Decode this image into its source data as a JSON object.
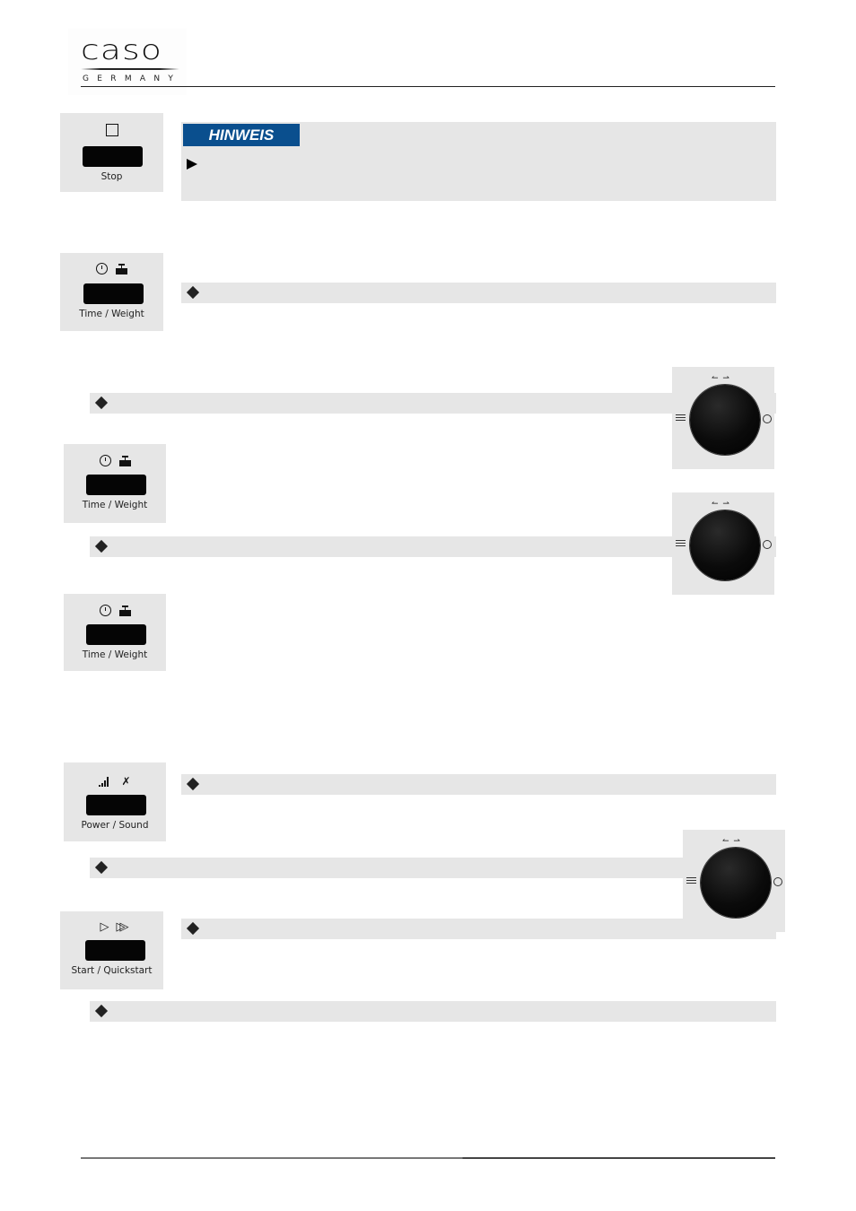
{
  "header": {
    "logo_word": "caso",
    "logo_sub": "GERMANY"
  },
  "hinweis": {
    "badge": "HINWEIS",
    "bullet_icon": "triangle-arrow-icon"
  },
  "buttons": [
    {
      "id": "stop",
      "label": "Stop",
      "icons": [
        "square-icon"
      ]
    },
    {
      "id": "time-weight-1",
      "label": "Time / Weight",
      "icons": [
        "clock-icon",
        "weight-icon"
      ]
    },
    {
      "id": "time-weight-2",
      "label": "Time / Weight",
      "icons": [
        "clock-icon",
        "weight-icon"
      ]
    },
    {
      "id": "time-weight-3",
      "label": "Time / Weight",
      "icons": [
        "clock-icon",
        "weight-icon"
      ]
    },
    {
      "id": "power-sound",
      "label": "Power / Sound",
      "icons": [
        "power-level-icon",
        "mute-icon"
      ]
    },
    {
      "id": "start-quickstart",
      "label": "Start / Quickstart",
      "icons": [
        "play-icon",
        "fast-forward-icon"
      ]
    }
  ],
  "glyphs": {
    "square": "☐",
    "clock": "◷",
    "weight": "▬",
    "play": "▷",
    "ffwd": "▷▷",
    "power": "▂▃▅",
    "mute": "✗",
    "knob_arrows": "↼ ⇀"
  },
  "knobs": [
    {
      "id": "knob-1",
      "left_icon": "menu-list-icon",
      "right_icon": "clock-icon"
    },
    {
      "id": "knob-2",
      "left_icon": "menu-list-icon",
      "right_icon": "clock-icon"
    },
    {
      "id": "knob-3",
      "left_icon": "menu-list-icon",
      "right_icon": "clock-icon"
    }
  ],
  "bullet_bars": [
    {
      "id": "bar-1",
      "icon": "diamond-bullet-icon"
    },
    {
      "id": "bar-2",
      "icon": "diamond-bullet-icon"
    },
    {
      "id": "bar-3",
      "icon": "diamond-bullet-icon"
    },
    {
      "id": "bar-4",
      "icon": "diamond-bullet-icon"
    },
    {
      "id": "bar-5",
      "icon": "diamond-bullet-icon"
    },
    {
      "id": "bar-6",
      "icon": "diamond-bullet-icon"
    },
    {
      "id": "bar-7",
      "icon": "diamond-bullet-icon"
    }
  ]
}
